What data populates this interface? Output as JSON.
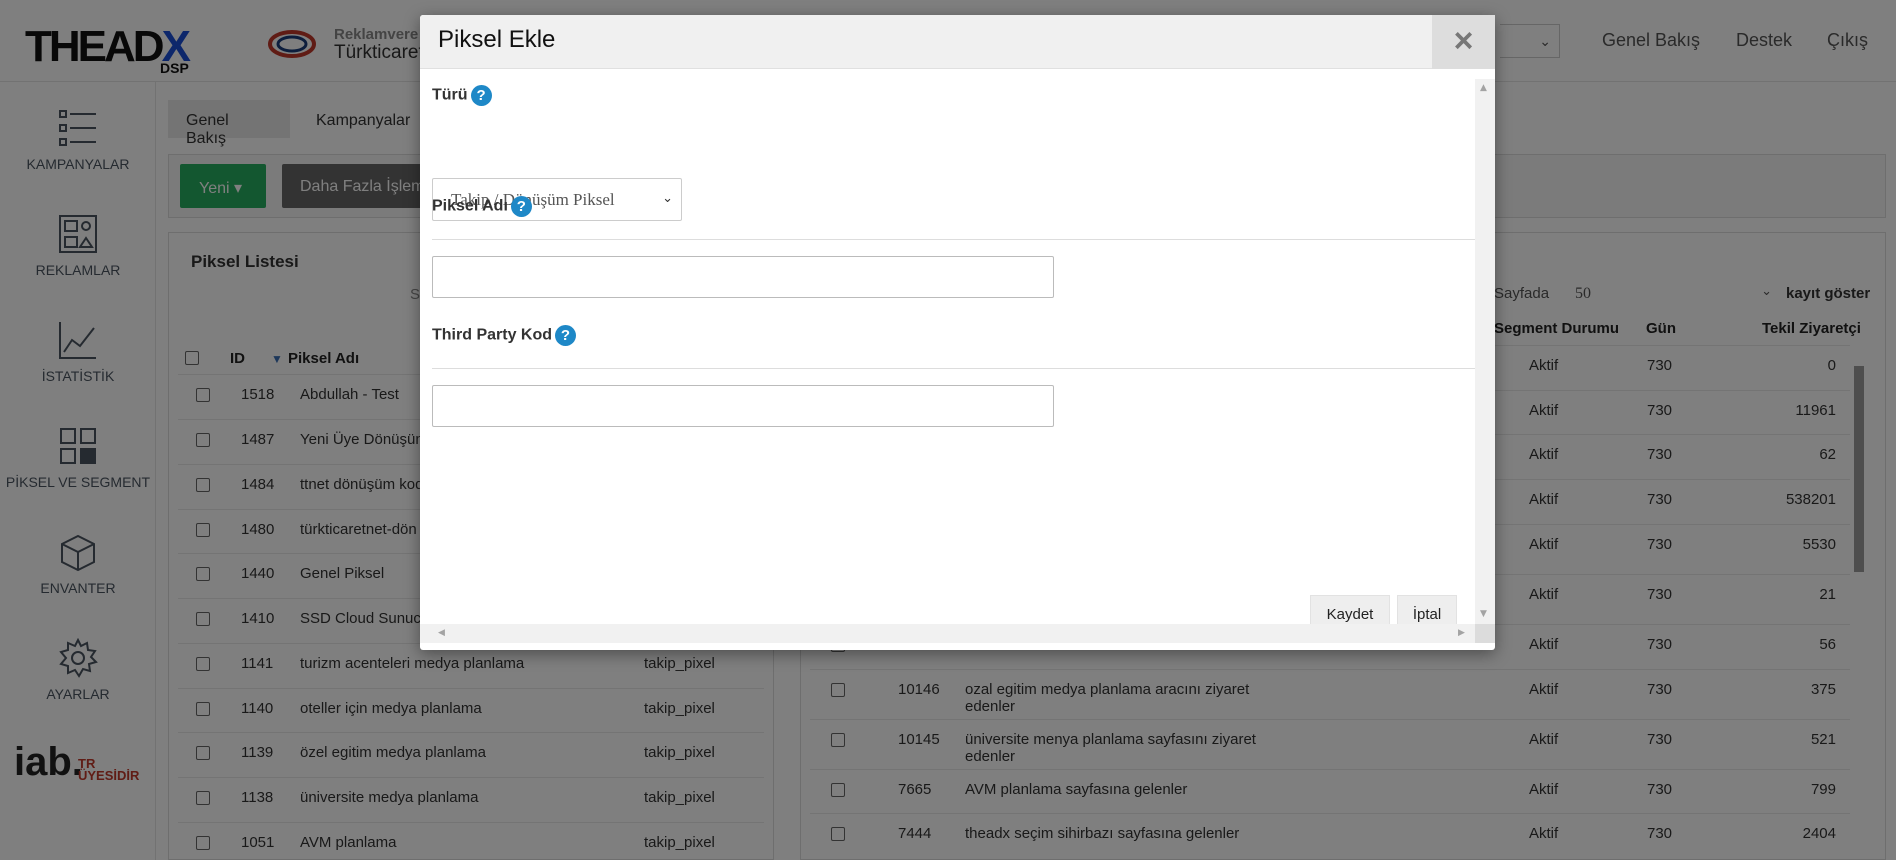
{
  "header": {
    "brand_sub": "DSP",
    "partner_line1": "Reklamvere",
    "partner_line2": "Türkticaret",
    "nav": [
      "Genel Bakış",
      "Destek",
      "Çıkış"
    ]
  },
  "sidebar": {
    "items": [
      {
        "label": "KAMPANYALAR",
        "icon": "campaigns-list-icon"
      },
      {
        "label": "REKLAMLAR",
        "icon": "ads-gallery-icon"
      },
      {
        "label": "İSTATİSTİK",
        "icon": "statistics-chart-icon"
      },
      {
        "label": "PİKSEL VE SEGMENT",
        "icon": "pixel-segment-icon"
      },
      {
        "label": "ENVANTER",
        "icon": "inventory-box-icon"
      },
      {
        "label": "AYARLAR",
        "icon": "settings-gear-icon"
      }
    ],
    "iab_logo": "iab.",
    "iab_badge_line1": "TR",
    "iab_badge_line2": "ÜYESİDİR"
  },
  "tabs": [
    "Genel Bakış",
    "Kampanyalar"
  ],
  "toolbar": {
    "new_label": "Yeni ▾",
    "more_label": "Daha Fazla İşlem"
  },
  "left_panel": {
    "title": "Piksel Listesi",
    "header_s": "S",
    "columns": {
      "id": "ID",
      "name": "Piksel Adı"
    },
    "rows": [
      {
        "id": "1518",
        "name": "Abdullah - Test",
        "type": ""
      },
      {
        "id": "1487",
        "name": "Yeni Üye Dönüşüm",
        "type": ""
      },
      {
        "id": "1484",
        "name": "ttnet dönüşüm kod",
        "type": ""
      },
      {
        "id": "1480",
        "name": "türkticaretnet-dön",
        "type": ""
      },
      {
        "id": "1440",
        "name": "Genel Piksel",
        "type": ""
      },
      {
        "id": "1410",
        "name": "SSD Cloud Sunuc",
        "type": ""
      },
      {
        "id": "1141",
        "name": "turizm acenteleri medya planlama",
        "type": "takip_pixel"
      },
      {
        "id": "1140",
        "name": "oteller için medya planlama",
        "type": "takip_pixel"
      },
      {
        "id": "1139",
        "name": "özel egitim medya planlama",
        "type": "takip_pixel"
      },
      {
        "id": "1138",
        "name": "üniversite medya planlama",
        "type": "takip_pixel"
      },
      {
        "id": "1051",
        "name": "AVM planlama",
        "type": "takip_pixel"
      }
    ]
  },
  "right_panel": {
    "per_page_label": "Sayfada",
    "per_page_value": "50",
    "per_page_suffix": "kayıt göster",
    "columns": {
      "status": "Segment Durumu",
      "days": "Gün",
      "unique": "Tekil Ziyaretçi"
    },
    "rows": [
      {
        "id": "",
        "name": "",
        "status": "Aktif",
        "days": "730",
        "unique": "0"
      },
      {
        "id": "",
        "name": "",
        "status": "Aktif",
        "days": "730",
        "unique": "11961"
      },
      {
        "id": "",
        "name": "",
        "status": "Aktif",
        "days": "730",
        "unique": "62"
      },
      {
        "id": "",
        "name": "",
        "status": "Aktif",
        "days": "730",
        "unique": "538201"
      },
      {
        "id": "",
        "name": "",
        "status": "Aktif",
        "days": "730",
        "unique": "5530"
      },
      {
        "id": "",
        "name": "",
        "status": "Aktif",
        "days": "730",
        "unique": "21"
      },
      {
        "id": "",
        "name": "",
        "status": "Aktif",
        "days": "730",
        "unique": "56"
      },
      {
        "id": "10146",
        "name": "ozal egitim medya planlama aracını ziyaret edenler",
        "status": "Aktif",
        "days": "730",
        "unique": "375"
      },
      {
        "id": "10145",
        "name": "üniversite menya planlama sayfasını ziyaret edenler",
        "status": "Aktif",
        "days": "730",
        "unique": "521"
      },
      {
        "id": "7665",
        "name": "AVM planlama sayfasına gelenler",
        "status": "Aktif",
        "days": "730",
        "unique": "799"
      },
      {
        "id": "7444",
        "name": "theadx seçim sihirbazı sayfasına gelenler",
        "status": "Aktif",
        "days": "730",
        "unique": "2404"
      }
    ]
  },
  "modal": {
    "title": "Piksel Ekle",
    "close_glyph": "×",
    "type_label": "Türü",
    "type_value": "Takip / Dönüşüm Piksel",
    "name_label": "Piksel Adı",
    "name_value": "",
    "third_party_label": "Third Party Kod",
    "third_party_value": "",
    "help_glyph": "?",
    "save_label": "Kaydet",
    "cancel_label": "İptal"
  }
}
